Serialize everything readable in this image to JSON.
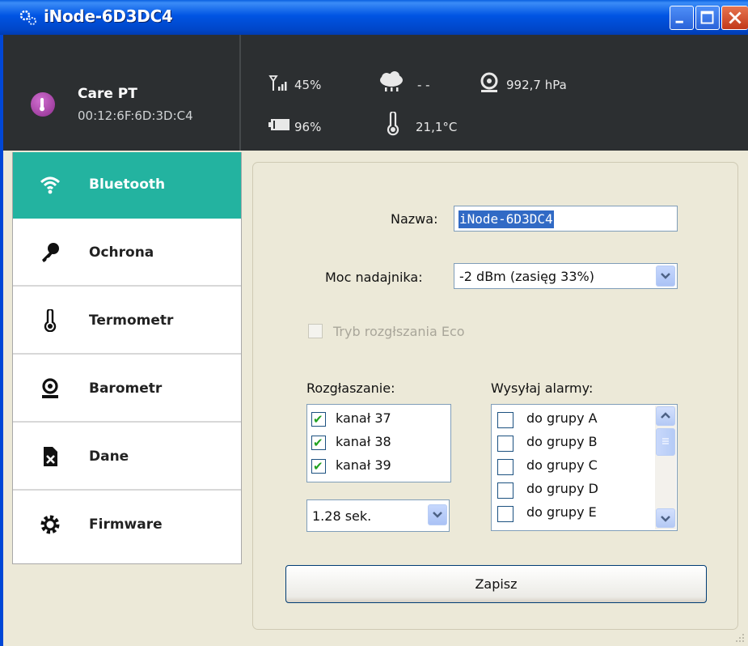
{
  "window": {
    "title": "iNode-6D3DC4"
  },
  "device": {
    "name": "Care PT",
    "mac": "00:12:6F:6D:3D:C4"
  },
  "status": {
    "signal": "45%",
    "weather": "- -",
    "pressure": "992,7 hPa",
    "battery": "96%",
    "temperature": "21,1°C"
  },
  "nav": [
    {
      "label": "Bluetooth",
      "icon": "wifi-icon",
      "active": true
    },
    {
      "label": "Ochrona",
      "icon": "key-icon"
    },
    {
      "label": "Termometr",
      "icon": "thermometer-icon"
    },
    {
      "label": "Barometr",
      "icon": "barometer-icon"
    },
    {
      "label": "Dane",
      "icon": "data-file-icon"
    },
    {
      "label": "Firmware",
      "icon": "gear-icon"
    }
  ],
  "form": {
    "name_label": "Nazwa:",
    "name_value": "iNode-6D3DC4",
    "power_label": "Moc nadajnika:",
    "power_value": "-2 dBm  (zasięg 33%)",
    "eco_label": "Tryb rozgłszania Eco",
    "eco_checked": false,
    "broadcast_label": "Rozgłaszanie:",
    "channels": [
      {
        "label": "kanał 37",
        "checked": true
      },
      {
        "label": "kanał 38",
        "checked": true
      },
      {
        "label": "kanał 39",
        "checked": true
      }
    ],
    "interval_value": "1.28 sek.",
    "alarms_label": "Wysyłaj alarmy:",
    "alarm_groups": [
      {
        "label": "do grupy A",
        "checked": false
      },
      {
        "label": "do grupy B",
        "checked": false
      },
      {
        "label": "do grupy C",
        "checked": false
      },
      {
        "label": "do grupy D",
        "checked": false
      },
      {
        "label": "do grupy E",
        "checked": false
      }
    ],
    "save_label": "Zapisz"
  },
  "colors": {
    "accent": "#23b3a0",
    "header_bg": "#2c2f31",
    "titlebar": "#0054e3"
  }
}
